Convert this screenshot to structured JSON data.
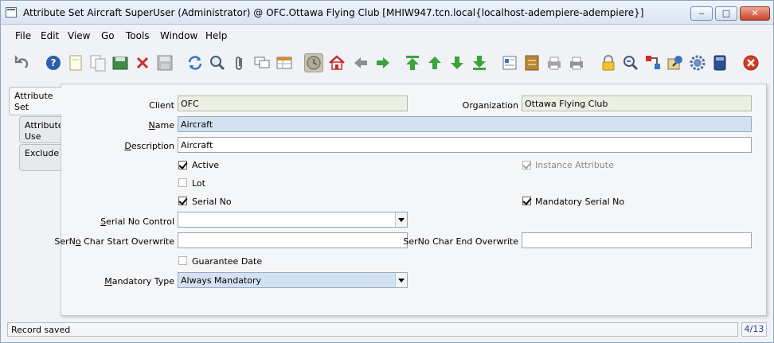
{
  "window": {
    "title": "Attribute Set  Aircraft  SuperUser (Administrator) @ OFC.Ottawa Flying Club [MHIW947.tcn.local{localhost-adempiere-adempiere}]",
    "min_label": "‒",
    "max_label": "□",
    "close_label": "✕"
  },
  "menu": {
    "file": "File",
    "edit": "Edit",
    "view": "View",
    "go": "Go",
    "tools": "Tools",
    "window": "Window",
    "help": "Help"
  },
  "toolbar": {
    "icons": [
      "undo-icon",
      "help-icon",
      "new-record-icon",
      "copy-record-icon",
      "save-and-new-icon",
      "delete-icon",
      "save-icon",
      "refresh-icon",
      "find-icon",
      "attachment-icon",
      "chat-icon",
      "grid-toggle-icon",
      "history-icon",
      "home-icon",
      "back-icon",
      "forward-icon",
      "first-record-icon",
      "previous-record-icon",
      "next-record-icon",
      "last-record-icon",
      "report-icon",
      "archive-icon",
      "print-preview-icon",
      "print-icon",
      "lock-icon",
      "zoom-across-icon",
      "active-workflows-icon",
      "requests-icon",
      "product-info-icon",
      "calculator-icon",
      "end-icon"
    ]
  },
  "tabs": [
    {
      "label": "Attribute Set",
      "active": true
    },
    {
      "label": "Attribute Use",
      "active": false
    },
    {
      "label": "Exclude",
      "active": false
    }
  ],
  "form": {
    "client_label": "Client",
    "client_value": "OFC",
    "organization_label": "Organization",
    "organization_value": "Ottawa Flying Club",
    "name_label": "Name",
    "name_value": "Aircraft",
    "description_label": "Description",
    "description_value": "Aircraft",
    "active_label": "Active",
    "active_checked": true,
    "instance_attribute_label": "Instance Attribute",
    "instance_attribute_checked": true,
    "lot_label": "Lot",
    "lot_checked": false,
    "serial_no_label": "Serial No",
    "serial_no_checked": true,
    "mandatory_serial_no_label": "Mandatory Serial No",
    "mandatory_serial_no_checked": true,
    "serial_no_control_label": "Serial No Control",
    "serial_no_control_value": "",
    "serno_start_label": "SerNo Char Start Overwrite",
    "serno_start_value": "",
    "serno_end_label": "SerNo Char End Overwrite",
    "serno_end_value": "",
    "guarantee_date_label": "Guarantee Date",
    "guarantee_date_checked": false,
    "mandatory_type_label": "Mandatory Type",
    "mandatory_type_value": "Always Mandatory"
  },
  "status": {
    "message": "Record saved",
    "record_position": "4/13"
  },
  "colors": {
    "mandatory_field": "#d3e2f2",
    "readonly_field": "#ecefe3",
    "accent_green": "#3aa33a",
    "close_red": "#d23b24"
  }
}
